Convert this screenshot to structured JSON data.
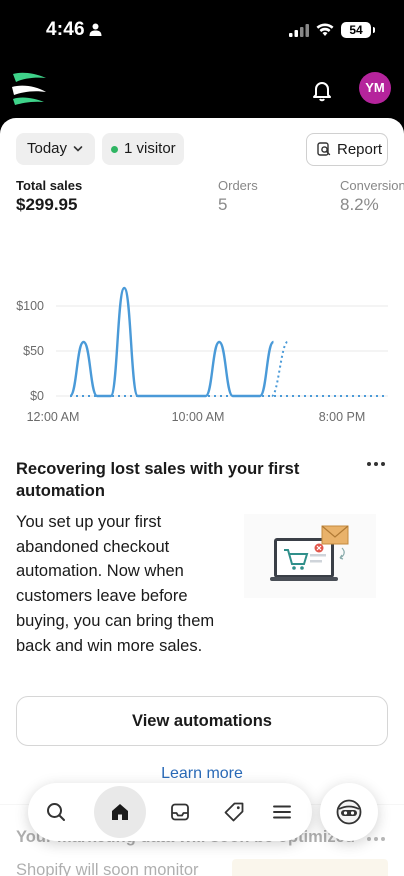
{
  "status_bar": {
    "time": "4:46",
    "battery": "54"
  },
  "header": {
    "avatar_initials": "YM",
    "brand_color": "#b5249c"
  },
  "filters": {
    "date_range": "Today",
    "visitors": "1 visitor",
    "report_label": "Report"
  },
  "metrics": [
    {
      "label": "Total sales",
      "value": "$299.95"
    },
    {
      "label": "Orders",
      "value": "5"
    },
    {
      "label": "Conversion",
      "value": "8.2%"
    }
  ],
  "chart_data": {
    "type": "line",
    "x_tick_labels": [
      "12:00 AM",
      "10:00 AM",
      "8:00 PM"
    ],
    "y_tick_labels": [
      "$100",
      "$50",
      "$0"
    ],
    "ylim": [
      0,
      120
    ],
    "x": [
      "12 AM",
      "1",
      "2",
      "3",
      "4",
      "5",
      "6",
      "7",
      "8",
      "9",
      "10",
      "11",
      "12 PM",
      "13",
      "14",
      "15",
      "16",
      "17",
      "18",
      "19",
      "20",
      "21",
      "22",
      "23"
    ],
    "series": [
      {
        "values": [
          0,
          60,
          0,
          0,
          120,
          0,
          0,
          0,
          0,
          0,
          0,
          60,
          0,
          0,
          0,
          60,
          null,
          null,
          null,
          null,
          null,
          null,
          null,
          null
        ],
        "style": "solid",
        "color": "#4a9ad8"
      },
      {
        "values": [
          0,
          0,
          0,
          0,
          0,
          0,
          0,
          0,
          0,
          0,
          0,
          0,
          0,
          0,
          0,
          0,
          0,
          0,
          0,
          0,
          0,
          0,
          0,
          0
        ],
        "style": "dotted",
        "color": "#4a9ad8"
      }
    ]
  },
  "promo": {
    "title": "Recovering lost sales with your first automation",
    "body": "You set up your first abandoned checkout automation. Now when customers leave before buying, you can bring them back and win more sales.",
    "button": "View automations",
    "link": "Learn more"
  },
  "next_card": {
    "title": "Your marketing data will soon be optimized",
    "body": "Shopify will soon monitor"
  },
  "nav": {
    "items": [
      {
        "icon": "search-icon"
      },
      {
        "icon": "home-icon",
        "active": true
      },
      {
        "icon": "orders-icon"
      },
      {
        "icon": "products-tag-icon"
      },
      {
        "icon": "menu-icon"
      }
    ],
    "sidekick_icon": "sidekick-icon"
  }
}
